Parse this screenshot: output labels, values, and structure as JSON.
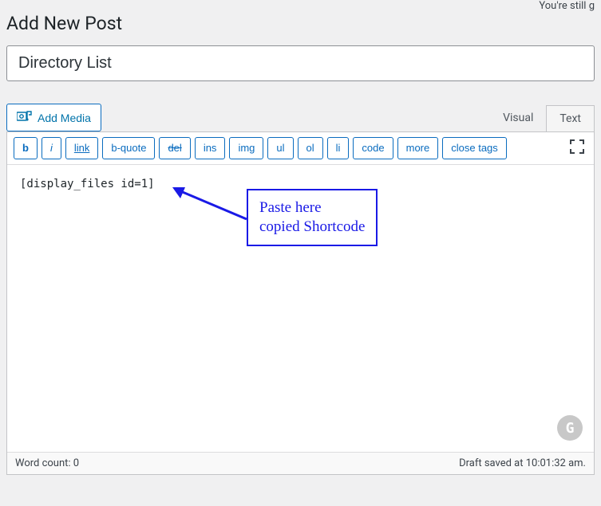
{
  "header": {
    "notice_fragment": "You're still g",
    "page_title": "Add New Post"
  },
  "post": {
    "title_value": "Directory List",
    "content": "[display_files id=1]"
  },
  "media": {
    "button_label": "Add Media"
  },
  "tabs": {
    "visual_label": "Visual",
    "text_label": "Text"
  },
  "quicktags": {
    "b": "b",
    "i": "i",
    "link": "link",
    "bquote": "b-quote",
    "del": "del",
    "ins": "ins",
    "img": "img",
    "ul": "ul",
    "ol": "ol",
    "li": "li",
    "code": "code",
    "more": "more",
    "close": "close tags"
  },
  "annotation": {
    "line1": "Paste here",
    "line2": "copied Shortcode"
  },
  "status": {
    "wordcount_label": "Word count: ",
    "wordcount_value": "0",
    "save_status": "Draft saved at 10:01:32 am."
  }
}
